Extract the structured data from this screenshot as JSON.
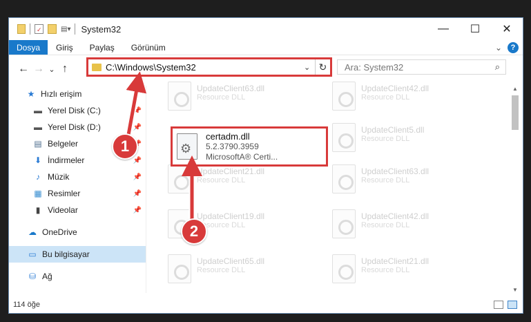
{
  "window": {
    "title": "System32",
    "controls": {
      "minimize": "—",
      "maximize": "☐",
      "close": "✕"
    }
  },
  "ribbon": {
    "file_tab": "Dosya",
    "tabs": [
      "Giriş",
      "Paylaş",
      "Görünüm"
    ],
    "expand_glyph": "⌄",
    "help_glyph": "?"
  },
  "navigation": {
    "back_glyph": "←",
    "forward_glyph": "→",
    "recent_glyph": "⌄",
    "up_glyph": "↑"
  },
  "address_bar": {
    "path": "C:\\Windows\\System32",
    "refresh_glyph": "↻"
  },
  "search": {
    "placeholder": "Ara: System32"
  },
  "sidebar": {
    "items": [
      {
        "label": "Hızlı erişim",
        "icon": "star-icon",
        "glyph": "★"
      },
      {
        "label": "Yerel Disk (C:)",
        "icon": "drive-icon",
        "glyph": "▬"
      },
      {
        "label": "Yerel Disk (D:)",
        "icon": "drive-icon",
        "glyph": "▬"
      },
      {
        "label": "Belgeler",
        "icon": "document-icon",
        "glyph": "▤"
      },
      {
        "label": "İndirmeler",
        "icon": "download-icon",
        "glyph": "⬇"
      },
      {
        "label": "Müzik",
        "icon": "music-icon",
        "glyph": "♪"
      },
      {
        "label": "Resimler",
        "icon": "picture-icon",
        "glyph": "▦"
      },
      {
        "label": "Videolar",
        "icon": "video-icon",
        "glyph": "▮"
      },
      {
        "label": "OneDrive",
        "icon": "cloud-icon",
        "glyph": "☁"
      },
      {
        "label": "Bu bilgisayar",
        "icon": "computer-icon",
        "glyph": "▭"
      },
      {
        "label": "Ağ",
        "icon": "network-icon",
        "glyph": "⛁"
      }
    ]
  },
  "files": {
    "left_column": [
      {
        "name": "UpdateClient63.dll",
        "desc": "Resource DLL"
      },
      {
        "name": "UpdateClient21.dll",
        "desc": "Resource DLL"
      },
      {
        "name": "UpdateClient19.dll",
        "desc": "Resource DLL"
      },
      {
        "name": "UpdateClient65.dll",
        "desc": "Resource DLL"
      }
    ],
    "right_column": [
      {
        "name": "UpdateClient42.dll",
        "desc": "Resource DLL"
      },
      {
        "name": "UpdateClient5.dll",
        "desc": "Resource DLL"
      },
      {
        "name": "UpdateClient63.dll",
        "desc": "Resource DLL"
      },
      {
        "name": "UpdateClient42.dll",
        "desc": "Resource DLL"
      },
      {
        "name": "UpdateClient21.dll",
        "desc": "Resource DLL"
      }
    ],
    "highlighted": {
      "name": "certadm.dll",
      "version": "5.2.3790.3959",
      "description": "MicrosoftA® Certi..."
    }
  },
  "status": {
    "item_count": "114 öğe"
  },
  "callouts": [
    "1",
    "2"
  ],
  "colors": {
    "accent": "#1979ca",
    "highlight_red": "#d83a3a",
    "selected_bg": "#cce4f7"
  }
}
